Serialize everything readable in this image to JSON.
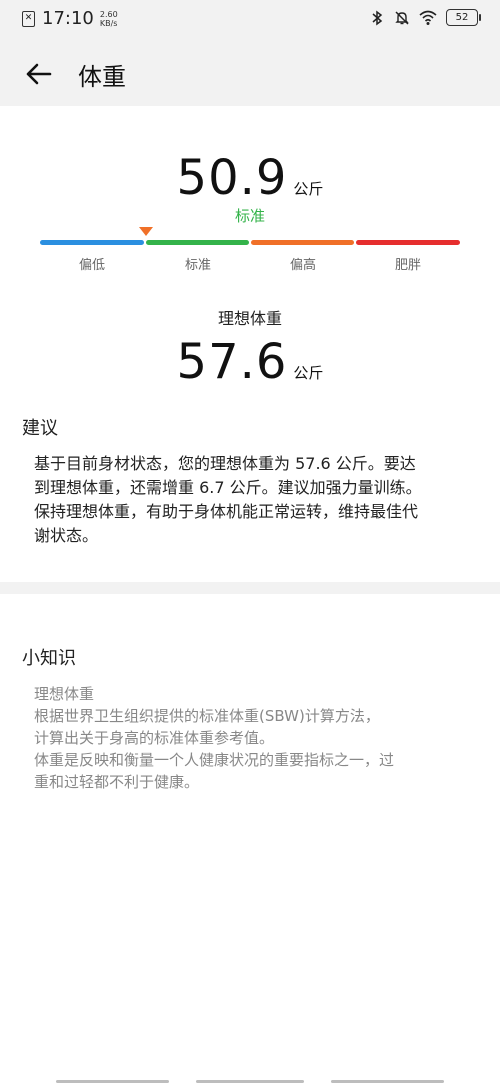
{
  "status_bar": {
    "time": "17:10",
    "net_speed_value": "2.60",
    "net_speed_unit": "KB/s",
    "battery": "52",
    "icons": [
      "notification-icon",
      "bluetooth-icon",
      "mute-icon",
      "wifi-icon",
      "battery-icon"
    ]
  },
  "header": {
    "back_icon": "arrow-left-icon",
    "title": "体重"
  },
  "weight": {
    "value": "50.9",
    "unit": "公斤",
    "status": "标准",
    "status_color": "#34b34a"
  },
  "scale": {
    "segments": [
      {
        "label": "偏低",
        "color": "#2b8fe0"
      },
      {
        "label": "标准",
        "color": "#34b34a"
      },
      {
        "label": "偏高",
        "color": "#f07028"
      },
      {
        "label": "肥胖",
        "color": "#e62e2e"
      }
    ],
    "marker_color": "#f07028"
  },
  "ideal": {
    "label": "理想体重",
    "value": "57.6",
    "unit": "公斤"
  },
  "advice": {
    "title": "建议",
    "lines": [
      "基于目前身材状态，您的理想体重为 57.6 公斤。要达",
      "到理想体重，还需增重 6.7 公斤。建议加强力量训练。",
      "保持理想体重，有助于身体机能正常运转，维持最佳代",
      "谢状态。"
    ]
  },
  "knowledge": {
    "title": "小知识",
    "lines": [
      "理想体重",
      "根据世界卫生组织提供的标准体重(SBW)计算方法，",
      "计算出关于身高的标准体重参考值。",
      "体重是反映和衡量一个人健康状况的重要指标之一，过",
      "重和过轻都不利于健康。"
    ]
  }
}
